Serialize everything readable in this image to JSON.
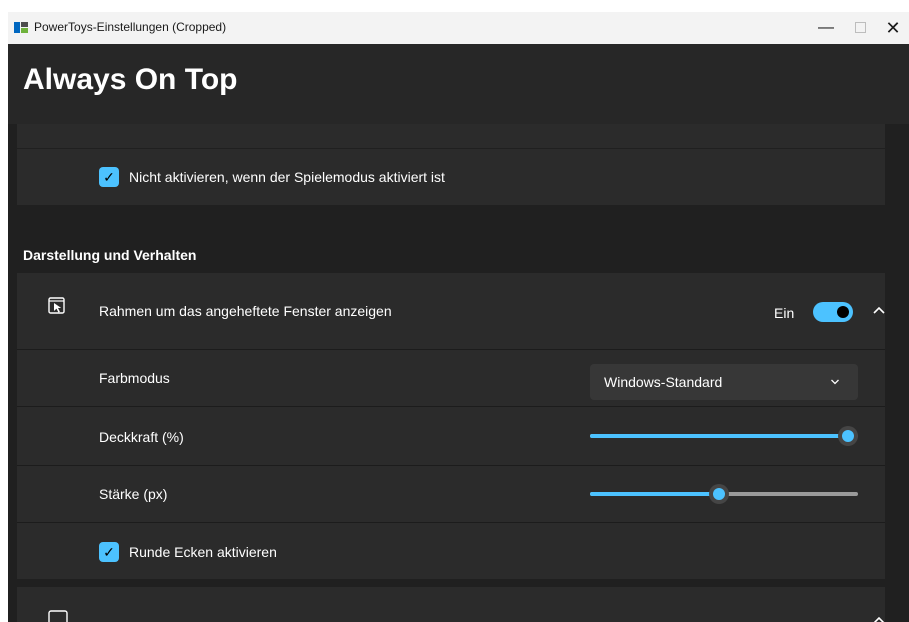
{
  "window": {
    "title": "PowerToys-Einstellungen (Cropped)"
  },
  "page": {
    "title": "Always On Top"
  },
  "game_mode": {
    "label": "Nicht aktivieren, wenn der Spielemodus aktiviert ist",
    "checked": true
  },
  "section": {
    "title": "Darstellung und Verhalten"
  },
  "border": {
    "label": "Rahmen um das angeheftete Fenster anzeigen",
    "toggle_label": "Ein",
    "enabled": true,
    "icon": "window-frame-icon"
  },
  "color_mode": {
    "label": "Farbmodus",
    "value": "Windows-Standard"
  },
  "opacity": {
    "label": "Deckkraft (%)",
    "value_fraction": 1.0
  },
  "thickness": {
    "label": "Stärke (px)",
    "value_fraction": 0.48
  },
  "rounded": {
    "label": "Runde Ecken aktivieren",
    "checked": true
  },
  "accent_color": "#4cc2ff"
}
